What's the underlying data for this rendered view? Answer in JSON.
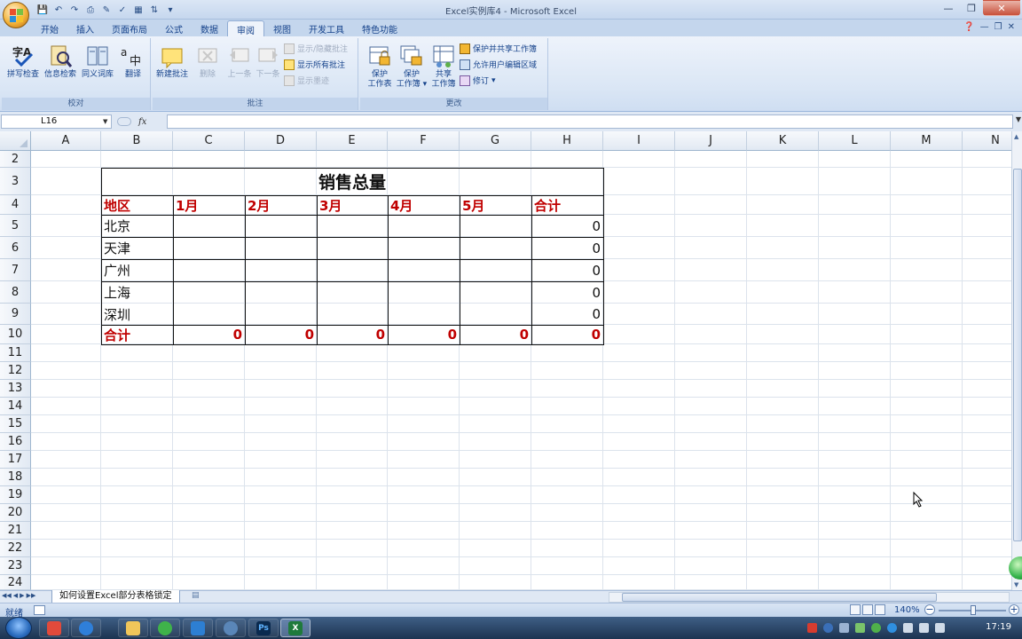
{
  "window": {
    "title": "Excel实例库4 - Microsoft Excel"
  },
  "ribbon": {
    "tabs": [
      "开始",
      "插入",
      "页面布局",
      "公式",
      "数据",
      "审阅",
      "视图",
      "开发工具",
      "特色功能"
    ],
    "active_tab": "审阅",
    "groups": {
      "proofing": {
        "label": "校对",
        "buttons": [
          "拼写检查",
          "信息检索",
          "同义词库",
          "翻译"
        ]
      },
      "comments": {
        "label": "批注",
        "new_comment": "新建批注",
        "delete": "删除",
        "previous": "上一条",
        "next": "下一条",
        "show_hide": "显示/隐藏批注",
        "show_all": "显示所有批注",
        "show_ink": "显示墨迹"
      },
      "changes": {
        "label": "更改",
        "protect_sheet": [
          "保护",
          "工作表"
        ],
        "protect_workbook": [
          "保护",
          "工作簿"
        ],
        "share_workbook": [
          "共享",
          "工作簿"
        ],
        "protect_and_share": "保护并共享工作簿",
        "allow_edit_ranges": "允许用户编辑区域",
        "track_changes": "修订"
      }
    }
  },
  "formula_bar": {
    "name_box": "L16",
    "fx": "fx",
    "formula": ""
  },
  "columns": [
    "A",
    "B",
    "C",
    "D",
    "E",
    "F",
    "G",
    "H",
    "I",
    "J",
    "K",
    "L",
    "M",
    "N"
  ],
  "rows": [
    "2",
    "3",
    "4",
    "5",
    "6",
    "7",
    "8",
    "9",
    "10",
    "11",
    "12",
    "13",
    "14",
    "15",
    "16",
    "17",
    "18",
    "19",
    "20",
    "21",
    "22",
    "23",
    "24"
  ],
  "table": {
    "title": "销售总量",
    "headers": [
      "地区",
      "1月",
      "2月",
      "3月",
      "4月",
      "5月",
      "合计"
    ],
    "regions": [
      "北京",
      "天津",
      "广州",
      "上海",
      "深圳"
    ],
    "row_totals": [
      "0",
      "0",
      "0",
      "0",
      "0"
    ],
    "total_label": "合计",
    "column_totals": [
      "0",
      "0",
      "0",
      "0",
      "0",
      "0"
    ]
  },
  "sheet_tab": "如何设置Excel部分表格锁定",
  "status": {
    "ready": "就绪",
    "zoom": "140%"
  },
  "taskbar": {
    "clock": "17:19"
  },
  "colors": {
    "header_red": "#c00000",
    "ribbon": "#dae6f5",
    "accent": "#15428b"
  }
}
